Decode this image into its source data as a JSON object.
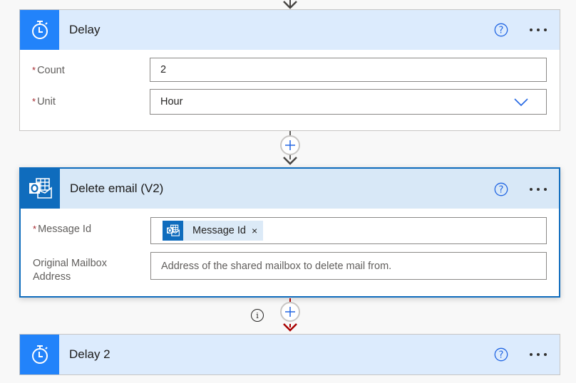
{
  "cards": {
    "delay": {
      "title": "Delay",
      "icon": "stopwatch-icon",
      "fields": {
        "count": {
          "label": "Count",
          "required": "*",
          "value": "2"
        },
        "unit": {
          "label": "Unit",
          "required": "*",
          "value": "Hour",
          "icon": "chevron-down-icon"
        }
      }
    },
    "delete_email": {
      "title": "Delete email (V2)",
      "icon": "outlook-icon",
      "fields": {
        "message_id": {
          "label": "Message Id",
          "required": "*",
          "token_label": "Message Id",
          "token_remove": "×"
        },
        "mailbox": {
          "label_line1": "Original Mailbox",
          "label_line2": "Address",
          "placeholder": "Address of the shared mailbox to delete mail from."
        }
      }
    },
    "delay2": {
      "title": "Delay 2",
      "icon": "stopwatch-icon"
    }
  },
  "actions": {
    "help_icon": "help-circle-icon",
    "more_icon": "more-horizontal-icon",
    "insert_step_icon": "plus-icon",
    "info_label": "i"
  },
  "colors": {
    "accent": "#2283fa",
    "outlook": "#0f6cbd",
    "header_bg": "#dcebfd",
    "required": "#a4262c",
    "error_connector": "#a80000"
  }
}
